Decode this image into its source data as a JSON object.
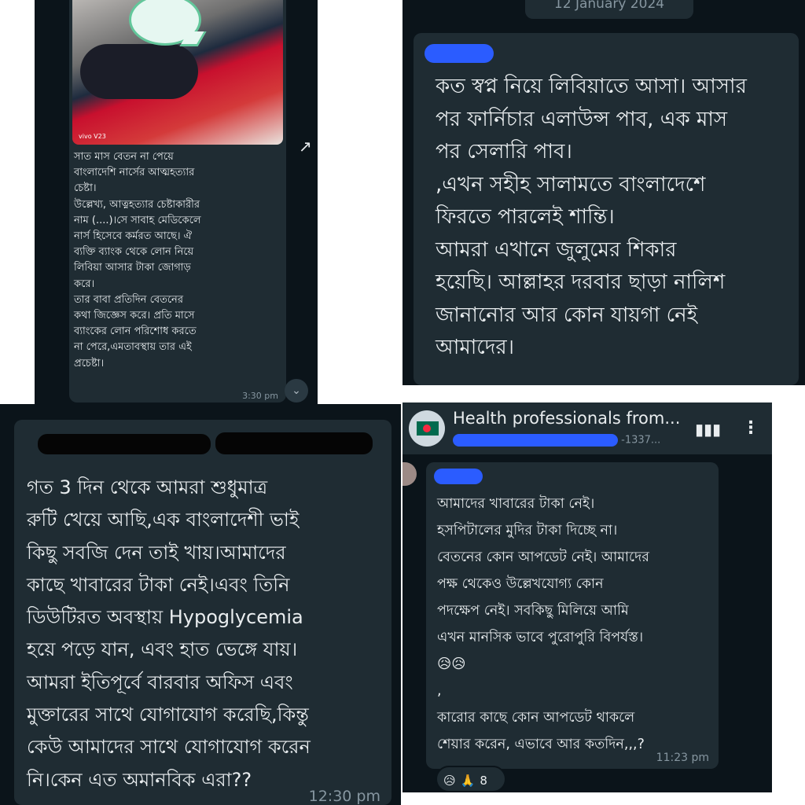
{
  "panel1": {
    "photo_watermark": "vivo V23",
    "message": "সাত মাস বেতন না পেয়ে\nবাংলাদেশি নার্সের আত্মহত্যার\nচেষ্টা।\nউল্লেখ্য, আত্নহত্যার চেষ্টাকারীর\nনাম (....)।সে সাবাহ মেডিকেলে\nনার্স হিসেবে কর্মরত আছে। ঐ\nব্যক্তি ব্যাংক থেকে লোন নিয়ে\nলিবিয়া আসার টাকা জোগাড়\nকরে।\nতার বাবা প্রতিদিন বেতনের\nকথা জিজ্ঞেস করে। প্রতি মাসে\nব্যাংকের লোন পরিশোধ করতে\nনা পেরে,এমতাবস্থায় তার এই\nপ্রচেষ্টা।",
    "time": "3:30 pm",
    "forward_icon": "↗",
    "scroll_down_icon": "⌄"
  },
  "panel2": {
    "date_chip": "12 January 2024",
    "message": "কত স্বপ্ন নিয়ে লিবিয়াতে আসা। আসার\nপর ফার্নিচার এলাউন্স পাব, এক মাস\nপর সেলারি পাব।\n,এখন সহীহ সালামতে বাংলাদেশে\nফিরতে পারলেই শান্তি।\n আমরা এখানে জুলুমের শিকার\nহয়েছি। আল্লাহর দরবার ছাড়া নালিশ\nজানানোর আর কোন যায়গা নেই\nআমাদের।"
  },
  "panel3": {
    "message": "গত 3 দিন থেকে আমরা শুধুমাত্র\nরুটি খেয়ে আছি,এক বাংলাদেশী ভাই\nকিছু সবজি দেন তাই খায়।আমাদের\nকাছে খাবারের টাকা নেই।এবং তিনি\nডিউটিরত অবস্থায় Hypoglycemia\nহয়ে পড়ে যান, এবং হাত ভেঙ্গে যায়।\nআমরা ইতিপূর্বে বারবার অফিস এবং\nমুক্তারের সাথে যোগাযোগ করেছি,কিন্তু\nকেউ আমাদের সাথে যোগাযোগ করেন\nনি।কেন এত অমানবিক এরা??",
    "time": "12:30 pm"
  },
  "panel4": {
    "group_title": "Health professionals from...",
    "group_subtitle": "-1337...",
    "message": "আমাদের খাবারের টাকা নেই।\nহসপিটালের মুদির টাকা দিচ্ছে না।\nবেতনের কোন আপডেট নেই। আমাদের\nপক্ষ থেকেও উল্লেখযোগ্য কোন\nপদক্ষেপ নেই।   সবকিছু মিলিয়ে আমি\nএখন মানসিক ভাবে পুরোপুরি বিপর্যস্ত।\n😥😥\n,\nকারোর কাছে কোন আপডেট থাকলে\nশেয়ার করেন, এভাবে আর কতদিন,,,?",
    "time": "11:23 pm",
    "reactions": {
      "emoji1": "😥",
      "emoji2": "🙏",
      "count": "8"
    },
    "audio_icon": "▮▮▮",
    "menu_icon": "⋮"
  },
  "colors": {
    "chat_background": "#0b141a",
    "bubble": "#1f2c33",
    "text": "#e9edef",
    "meta": "#8696a0",
    "redaction": "#2b5cff"
  }
}
